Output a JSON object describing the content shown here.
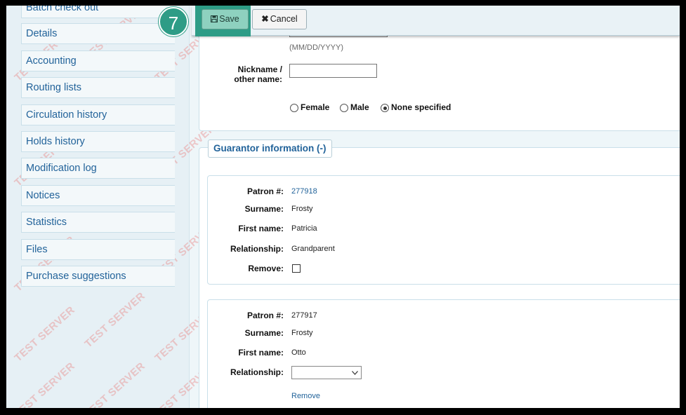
{
  "sidebar": {
    "items": [
      {
        "label": "Batch check out"
      },
      {
        "label": "Details"
      },
      {
        "label": "Accounting"
      },
      {
        "label": "Routing lists"
      },
      {
        "label": "Circulation history"
      },
      {
        "label": "Holds history"
      },
      {
        "label": "Modification log"
      },
      {
        "label": "Notices"
      },
      {
        "label": "Statistics"
      },
      {
        "label": "Files"
      },
      {
        "label": "Purchase suggestions"
      }
    ],
    "watermark": "TEST SERVER"
  },
  "toolbar": {
    "step_number": "7",
    "save_label": "Save",
    "cancel_label": "Cancel",
    "highlight_color": "#2e9c86"
  },
  "identity": {
    "date_format_hint": "(MM/DD/YYYY)",
    "nickname_label_line1": "Nickname /",
    "nickname_label_line2": "other name:",
    "nickname_value": "",
    "gender_options": [
      {
        "label": "Female",
        "selected": false
      },
      {
        "label": "Male",
        "selected": false
      },
      {
        "label": "None specified",
        "selected": true
      }
    ]
  },
  "guarantor": {
    "legend": "Guarantor information (-)",
    "entries": [
      {
        "patron_label": "Patron #:",
        "patron_number": "277918",
        "surname_label": "Surname:",
        "surname": "Frosty",
        "firstname_label": "First name:",
        "firstname": "Patricia",
        "relationship_label": "Relationship:",
        "relationship": "Grandparent",
        "remove_label": "Remove:"
      },
      {
        "patron_label": "Patron #:",
        "patron_number": "277917",
        "surname_label": "Surname:",
        "surname": "Frosty",
        "firstname_label": "First name:",
        "firstname": "Otto",
        "relationship_label": "Relationship:",
        "relationship": "",
        "remove_link": "Remove"
      }
    ]
  }
}
